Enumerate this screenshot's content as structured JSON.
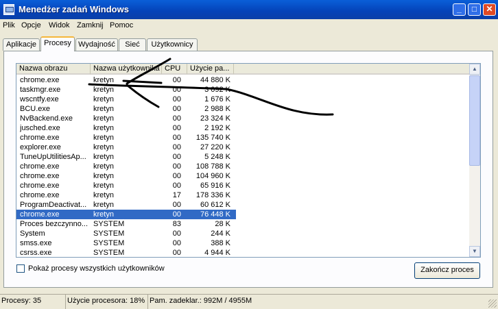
{
  "window": {
    "title": "Menedżer zadań Windows",
    "minimize": "_",
    "maximize": "□",
    "close": "✕"
  },
  "menu": [
    "Plik",
    "Opcje",
    "Widok",
    "Zamknij",
    "Pomoc"
  ],
  "tabs": [
    "Aplikacje",
    "Procesy",
    "Wydajność",
    "Sieć",
    "Użytkownicy"
  ],
  "active_tab": "Procesy",
  "columns": [
    "Nazwa obrazu",
    "Nazwa użytkownika",
    "CPU",
    "Użycie pa..."
  ],
  "rows": [
    [
      "chrome.exe",
      "kretyn",
      "00",
      "44 880 K"
    ],
    [
      "taskmgr.exe",
      "kretyn",
      "00",
      "3 092 K"
    ],
    [
      "wscntfy.exe",
      "kretyn",
      "00",
      "1 676 K"
    ],
    [
      "BCU.exe",
      "kretyn",
      "00",
      "2 988 K"
    ],
    [
      "NvBackend.exe",
      "kretyn",
      "00",
      "23 324 K"
    ],
    [
      "jusched.exe",
      "kretyn",
      "00",
      "2 192 K"
    ],
    [
      "chrome.exe",
      "kretyn",
      "00",
      "135 740 K"
    ],
    [
      "explorer.exe",
      "kretyn",
      "00",
      "27 220 K"
    ],
    [
      "TuneUpUtilitiesAp...",
      "kretyn",
      "00",
      "5 248 K"
    ],
    [
      "chrome.exe",
      "kretyn",
      "00",
      "108 788 K"
    ],
    [
      "chrome.exe",
      "kretyn",
      "00",
      "104 960 K"
    ],
    [
      "chrome.exe",
      "kretyn",
      "00",
      "65 916 K"
    ],
    [
      "chrome.exe",
      "kretyn",
      "17",
      "178 336 K"
    ],
    [
      "ProgramDeactivat...",
      "kretyn",
      "00",
      "60 612 K"
    ],
    [
      "chrome.exe",
      "kretyn",
      "00",
      "76 448 K"
    ],
    [
      "Proces bezczynno...",
      "SYSTEM",
      "83",
      "28 K"
    ],
    [
      "System",
      "SYSTEM",
      "00",
      "244 K"
    ],
    [
      "smss.exe",
      "SYSTEM",
      "00",
      "388 K"
    ],
    [
      "csrss.exe",
      "SYSTEM",
      "00",
      "4 944 K"
    ]
  ],
  "selected_row": 14,
  "show_all_label": "Pokaż procesy wszystkich użytkowników",
  "end_process_label": "Zakończ proces",
  "status": {
    "processes": "Procesy: 35",
    "cpu": "Użycie procesora: 18%",
    "mem": "Pam. zadeklar.: 992M / 4955M"
  },
  "colors": {
    "titlebar": "#0442b8",
    "selection": "#316ac5",
    "annotation_ink": "#000000"
  }
}
